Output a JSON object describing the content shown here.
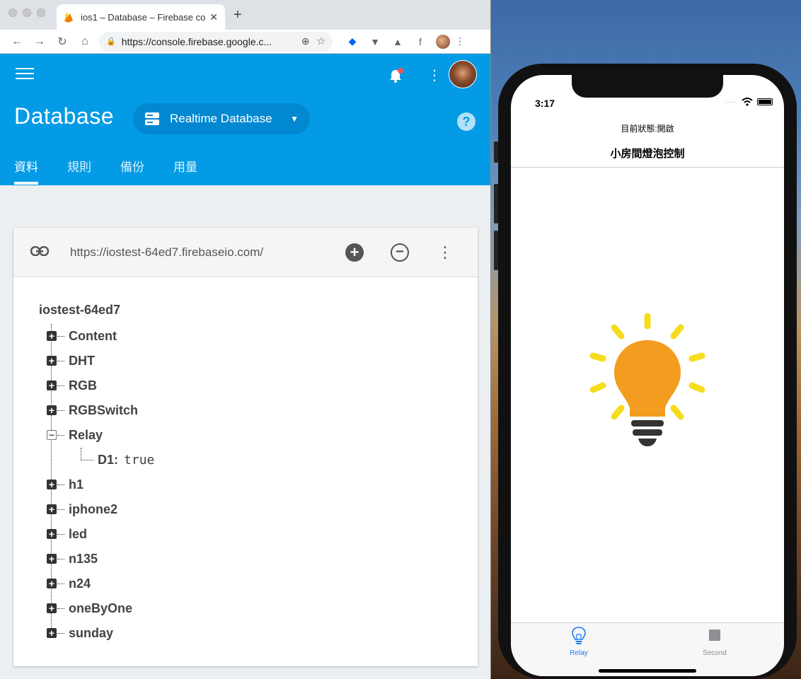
{
  "browser": {
    "tab_title": "ios1 – Database – Firebase con",
    "url": "https://console.firebase.google.c..."
  },
  "firebase": {
    "page_title": "Database",
    "db_selector": "Realtime Database",
    "tabs": [
      "資料",
      "規則",
      "備份",
      "用量"
    ],
    "db_url": "https://iostest-64ed7.firebaseio.com/",
    "tree": {
      "root": "iostest-64ed7",
      "nodes": [
        {
          "key": "Content",
          "expanded": false
        },
        {
          "key": "DHT",
          "expanded": false
        },
        {
          "key": "RGB",
          "expanded": false
        },
        {
          "key": "RGBSwitch",
          "expanded": false
        },
        {
          "key": "Relay",
          "expanded": true,
          "child_key": "D1:",
          "child_value": "true"
        },
        {
          "key": "h1",
          "expanded": false
        },
        {
          "key": "iphone2",
          "expanded": false
        },
        {
          "key": "led",
          "expanded": false
        },
        {
          "key": "n135",
          "expanded": false
        },
        {
          "key": "n24",
          "expanded": false
        },
        {
          "key": "oneByOne",
          "expanded": false
        },
        {
          "key": "sunday",
          "expanded": false
        }
      ]
    }
  },
  "phone": {
    "time": "3:17",
    "status_text": "目前狀態:開啟",
    "nav_title": "小房間燈泡控制",
    "tab_relay": "Relay",
    "tab_second": "Second",
    "bulb_color": "#f39c1f",
    "ray_color": "#f5dd1e",
    "tab_active_color": "#1a7cf0"
  },
  "colors": {
    "firebase_blue": "#039be5",
    "selector_blue": "#0288d1"
  }
}
